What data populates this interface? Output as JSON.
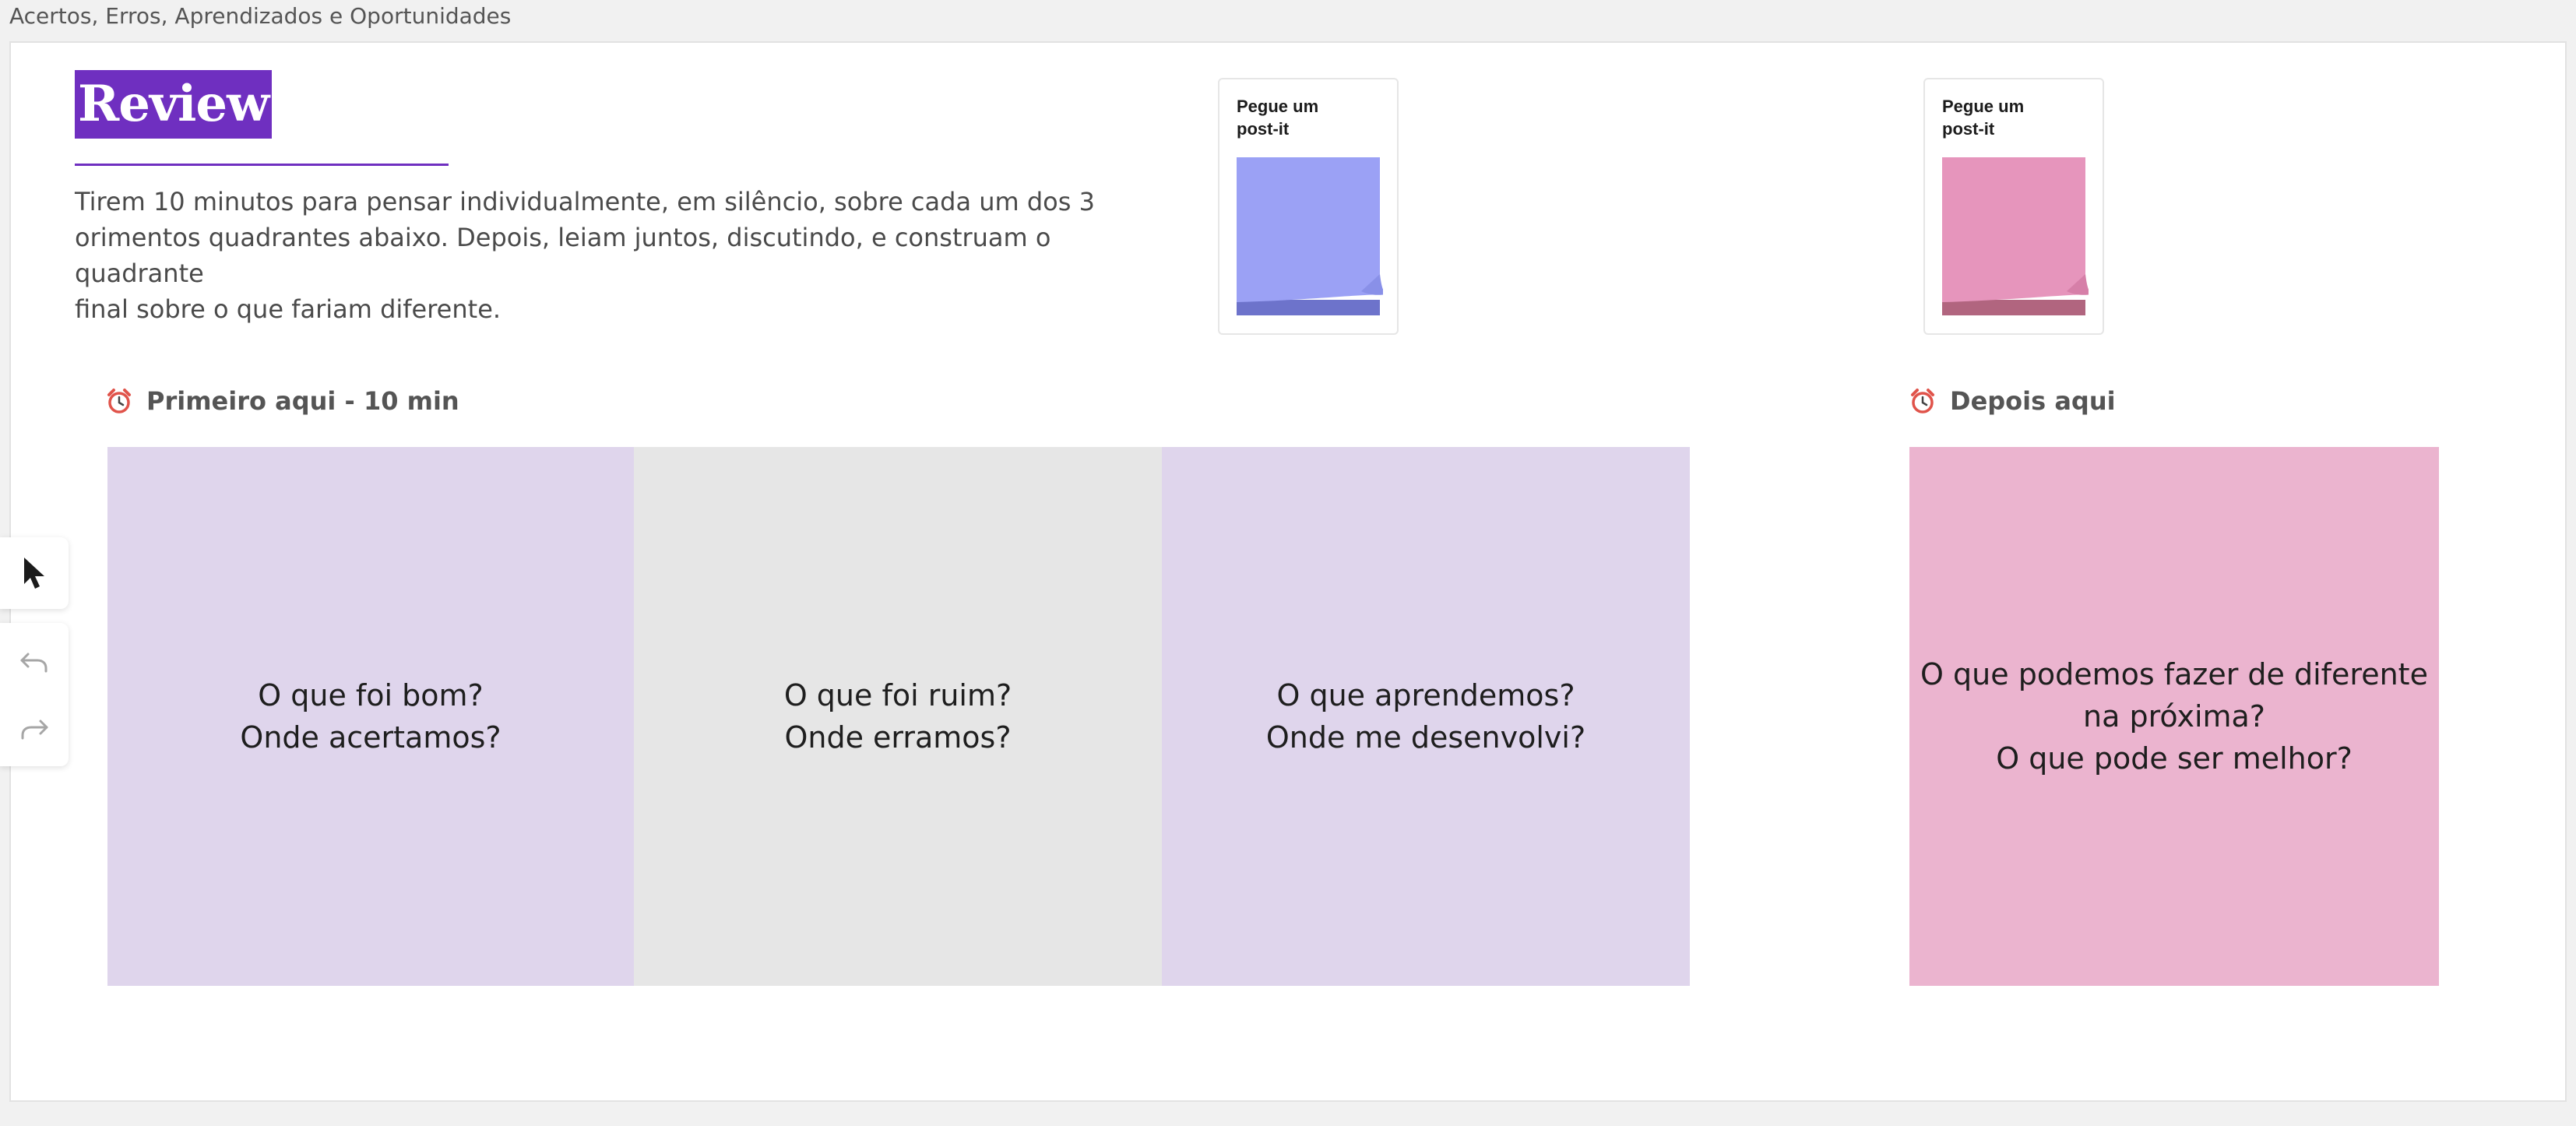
{
  "frame": {
    "title": "Acertos, Erros, Aprendizados e Oportunidades"
  },
  "header": {
    "badge": "Review",
    "instructions": "Tirem 10 minutos para pensar individualmente, em silêncio, sobre cada um dos 3\norimentos quadrantes abaixo. Depois, leiam juntos, discutindo, e construam o quadrante\nfinal sobre o que fariam diferente."
  },
  "postit_cards": [
    {
      "label": "Pegue um\npost-it",
      "color": "#9ba1f5",
      "shade": "#6d73cb"
    },
    {
      "label": "Pegue um\npost-it",
      "color": "#e695bc",
      "shade": "#b1657f"
    }
  ],
  "sections": {
    "first": {
      "label": "Primeiro aqui - 10 min",
      "icon": "alarm-clock-icon"
    },
    "second": {
      "label": "Depois aqui",
      "icon": "alarm-clock-icon"
    }
  },
  "quadrants": [
    {
      "text": "O que foi bom?\nOnde acertamos?",
      "color": "#dfd5ec"
    },
    {
      "text": "O que foi ruim?\nOnde erramos?",
      "color": "#e6e6e6"
    },
    {
      "text": "O que aprendemos?\nOnde me desenvolvi?",
      "color": "#dfd5ec"
    },
    {
      "text": "O que podemos fazer de diferente\nna próxima?\nO que pode ser melhor?",
      "color": "#ebb4cf"
    }
  ],
  "toolbar": {
    "tools": [
      {
        "name": "select",
        "icon": "cursor-icon"
      },
      {
        "name": "undo",
        "icon": "undo-icon"
      },
      {
        "name": "redo",
        "icon": "redo-icon"
      }
    ]
  },
  "colors": {
    "accent": "#6f2fc0",
    "clock": "#e0534a"
  }
}
